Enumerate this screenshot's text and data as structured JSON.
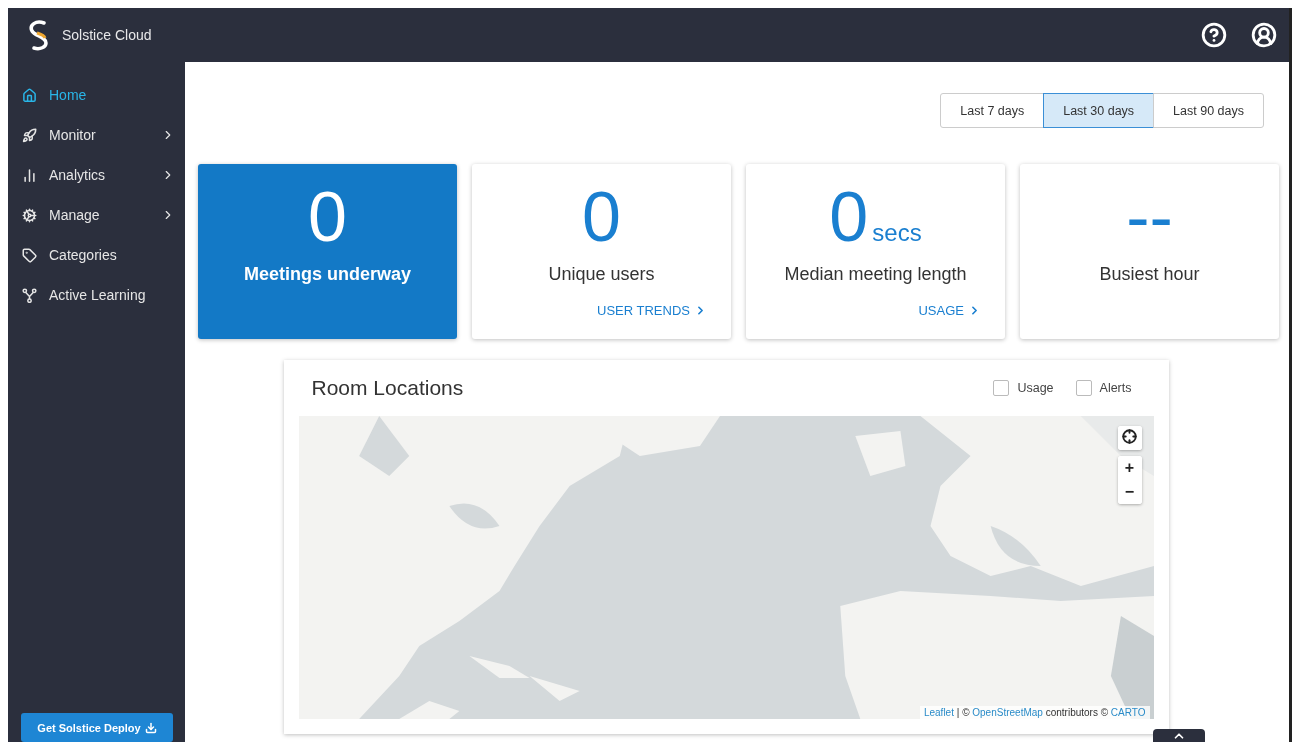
{
  "header": {
    "title": "Solstice Cloud"
  },
  "sidebar": {
    "items": [
      {
        "label": "Home",
        "selected": true,
        "expandable": false
      },
      {
        "label": "Monitor",
        "selected": false,
        "expandable": true
      },
      {
        "label": "Analytics",
        "selected": false,
        "expandable": true
      },
      {
        "label": "Manage",
        "selected": false,
        "expandable": true
      },
      {
        "label": "Categories",
        "selected": false,
        "expandable": false
      },
      {
        "label": "Active Learning",
        "selected": false,
        "expandable": false
      }
    ],
    "deploy_button": "Get Solstice Deploy"
  },
  "range_tabs": [
    {
      "label": "Last 7 days",
      "selected": false
    },
    {
      "label": "Last 30 days",
      "selected": true
    },
    {
      "label": "Last 90 days",
      "selected": false
    }
  ],
  "stats": [
    {
      "value": "0",
      "label": "Meetings underway",
      "highlighted": true
    },
    {
      "value": "0",
      "label": "Unique users",
      "highlighted": false,
      "link": "USER TRENDS"
    },
    {
      "value": "0",
      "unit": "secs",
      "label": "Median meeting length",
      "highlighted": false,
      "link": "USAGE"
    },
    {
      "value": "--",
      "label": "Busiest hour",
      "highlighted": false
    }
  ],
  "map_panel": {
    "title": "Room Locations",
    "toggles": [
      {
        "label": "Usage",
        "checked": false
      },
      {
        "label": "Alerts",
        "checked": false
      }
    ],
    "zoom_in": "+",
    "zoom_out": "−",
    "attribution": [
      {
        "text": "Leaflet",
        "kind": "link"
      },
      {
        "text": "| ©",
        "kind": "text"
      },
      {
        "text": "OpenStreetMap",
        "kind": "link"
      },
      {
        "text": "contributors ©",
        "kind": "text"
      },
      {
        "text": "CARTO",
        "kind": "link"
      }
    ]
  }
}
